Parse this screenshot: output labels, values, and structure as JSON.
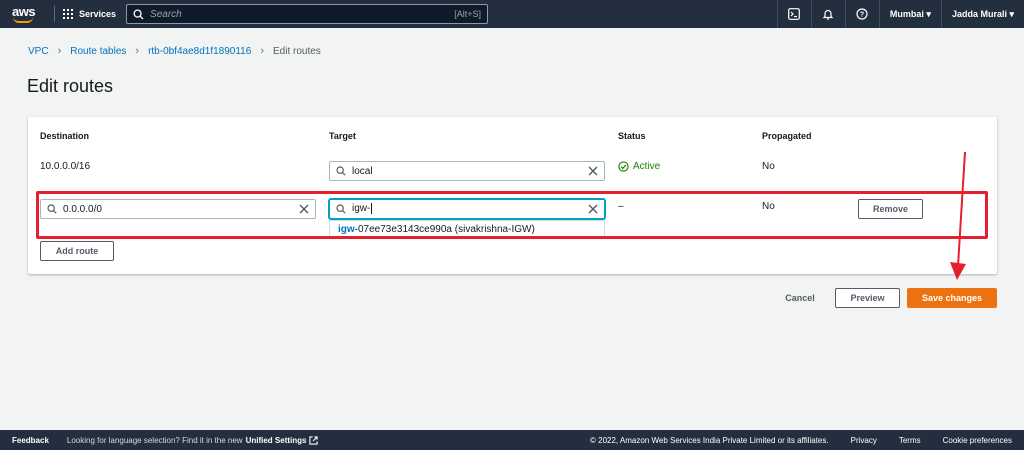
{
  "nav": {
    "logo_text": "aws",
    "services_label": "Services",
    "search_placeholder": "Search",
    "search_shortcut": "[Alt+S]",
    "region": "Mumbai ▾",
    "user": "Jadda Murali ▾"
  },
  "breadcrumb": {
    "items": [
      "VPC",
      "Route tables",
      "rtb-0bf4ae8d1f1890116"
    ],
    "current": "Edit routes"
  },
  "page_title": "Edit routes",
  "table": {
    "headers": {
      "destination": "Destination",
      "target": "Target",
      "status": "Status",
      "propagated": "Propagated"
    },
    "row1": {
      "destination": "10.0.0.0/16",
      "target": "local",
      "status": "Active",
      "propagated": "No"
    },
    "row2": {
      "destination": "0.0.0.0/0",
      "target": "igw-",
      "status": "–",
      "propagated": "No",
      "remove_label": "Remove"
    },
    "suggestion": {
      "match": "igw-",
      "rest": "07ee73e3143ce990a (sivakrishna-IGW)"
    },
    "add_route_label": "Add route"
  },
  "actions": {
    "cancel": "Cancel",
    "preview": "Preview",
    "save": "Save changes"
  },
  "footer": {
    "feedback": "Feedback",
    "language_note": "Looking for language selection? Find it in the new",
    "unified_settings": "Unified Settings",
    "copyright": "© 2022, Amazon Web Services India Private Limited or its affiliates.",
    "privacy": "Privacy",
    "terms": "Terms",
    "cookies": "Cookie preferences"
  },
  "colors": {
    "nav_bg": "#232f3e",
    "accent_orange": "#ec7211",
    "link_blue": "#0073bb",
    "status_green": "#1d8102",
    "annotation_red": "#e5202e"
  }
}
